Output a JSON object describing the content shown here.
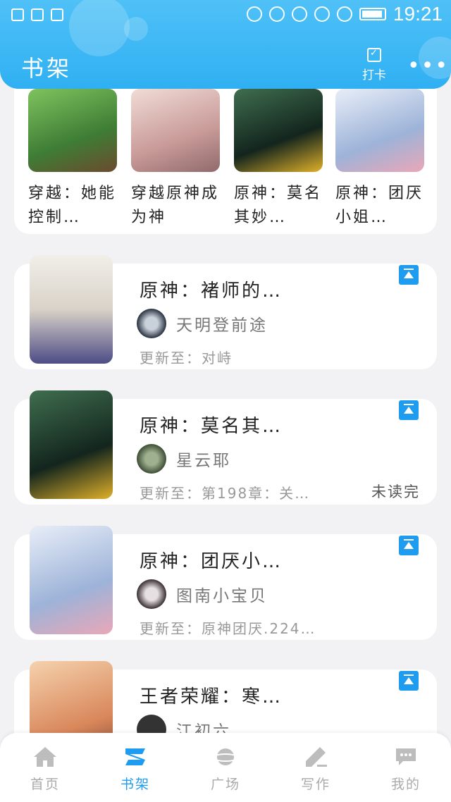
{
  "status_bar": {
    "time": "19:21"
  },
  "header": {
    "title": "书架",
    "checkin_label": "打卡",
    "more_label": "•••"
  },
  "grid": [
    {
      "title": "穿越：她能控制…",
      "cover_color": "#4f9a45"
    },
    {
      "title": "穿越原神成为神",
      "cover_color": "#d9b7b5"
    },
    {
      "title": "原神：莫名其妙…",
      "cover_color": "#1d3b32"
    },
    {
      "title": "原神：团厌小姐…",
      "cover_color": "#cfd8ea"
    }
  ],
  "books": [
    {
      "title": "原神：褚师的…",
      "author": "天明登前途",
      "update": "更新至：对峙",
      "unread": "",
      "cover_color": "#e6e3df",
      "avatar_color": "#2a3340"
    },
    {
      "title": "原神：莫名其…",
      "author": "星云耶",
      "update": "更新至：第198章：关…",
      "unread": "未读完",
      "cover_color": "#1d3b32",
      "avatar_color": "#5d6f53"
    },
    {
      "title": "原神：团厌小…",
      "author": "图南小宝贝",
      "update": "更新至：原神团厌.224…",
      "unread": "",
      "cover_color": "#cfd8ea",
      "avatar_color": "#3a3035"
    },
    {
      "title": "王者荣耀：寒…",
      "author": "江初六",
      "update": "",
      "unread": "",
      "cover_color": "#e6a877",
      "avatar_color": "#333333"
    }
  ],
  "nav": [
    {
      "label": "首页",
      "active": false
    },
    {
      "label": "书架",
      "active": true
    },
    {
      "label": "广场",
      "active": false
    },
    {
      "label": "写作",
      "active": false
    },
    {
      "label": "我的",
      "active": false
    }
  ],
  "colors": {
    "accent": "#1e9cf0",
    "header": "#2fb0f2",
    "inactive_nav": "#aaaaaa"
  }
}
